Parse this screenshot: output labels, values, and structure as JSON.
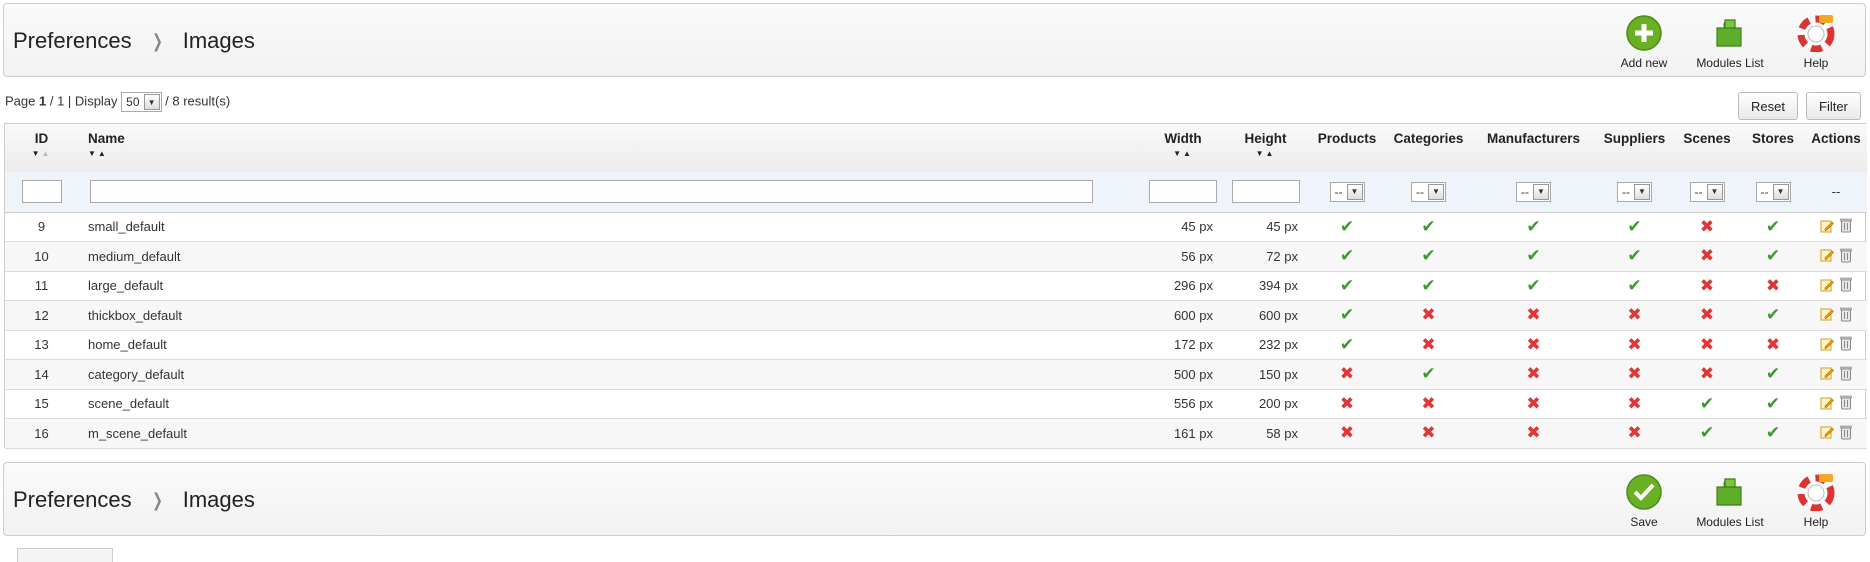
{
  "header": {
    "breadcrumb": [
      "Preferences",
      "Images"
    ],
    "buttons": [
      {
        "label": "Add new",
        "icon": "add-icon"
      },
      {
        "label": "Modules List",
        "icon": "puzzle-icon"
      },
      {
        "label": "Help",
        "icon": "lifebuoy-icon"
      }
    ]
  },
  "pager": {
    "page_label": "Page",
    "page_current": "1",
    "page_total": "/ 1 | Display",
    "per_page": "50",
    "results": "/ 8 result(s)"
  },
  "actions": {
    "reset": "Reset",
    "filter": "Filter"
  },
  "columns": [
    "ID",
    "Name",
    "Width",
    "Height",
    "Products",
    "Categories",
    "Manufacturers",
    "Suppliers",
    "Scenes",
    "Stores",
    "Actions"
  ],
  "filters": {
    "select_value": "--",
    "actions_value": "--"
  },
  "rows": [
    {
      "id": "9",
      "name": "small_default",
      "width": "45 px",
      "height": "45 px",
      "products": true,
      "categories": true,
      "manufacturers": true,
      "suppliers": true,
      "scenes": false,
      "stores": true
    },
    {
      "id": "10",
      "name": "medium_default",
      "width": "56 px",
      "height": "72 px",
      "products": true,
      "categories": true,
      "manufacturers": true,
      "suppliers": true,
      "scenes": false,
      "stores": true
    },
    {
      "id": "11",
      "name": "large_default",
      "width": "296 px",
      "height": "394 px",
      "products": true,
      "categories": true,
      "manufacturers": true,
      "suppliers": true,
      "scenes": false,
      "stores": false
    },
    {
      "id": "12",
      "name": "thickbox_default",
      "width": "600 px",
      "height": "600 px",
      "products": true,
      "categories": false,
      "manufacturers": false,
      "suppliers": false,
      "scenes": false,
      "stores": true
    },
    {
      "id": "13",
      "name": "home_default",
      "width": "172 px",
      "height": "232 px",
      "products": true,
      "categories": false,
      "manufacturers": false,
      "suppliers": false,
      "scenes": false,
      "stores": false
    },
    {
      "id": "14",
      "name": "category_default",
      "width": "500 px",
      "height": "150 px",
      "products": false,
      "categories": true,
      "manufacturers": false,
      "suppliers": false,
      "scenes": false,
      "stores": true
    },
    {
      "id": "15",
      "name": "scene_default",
      "width": "556 px",
      "height": "200 px",
      "products": false,
      "categories": false,
      "manufacturers": false,
      "suppliers": false,
      "scenes": true,
      "stores": true
    },
    {
      "id": "16",
      "name": "m_scene_default",
      "width": "161 px",
      "height": "58 px",
      "products": false,
      "categories": false,
      "manufacturers": false,
      "suppliers": false,
      "scenes": true,
      "stores": true
    }
  ],
  "footer": {
    "breadcrumb": [
      "Preferences",
      "Images"
    ],
    "buttons": [
      {
        "label": "Save",
        "icon": "save-icon"
      },
      {
        "label": "Modules List",
        "icon": "puzzle-icon"
      },
      {
        "label": "Help",
        "icon": "lifebuoy-icon"
      }
    ]
  },
  "colors": {
    "check": "#3c9a2f",
    "cross": "#e03636",
    "add": "#6ab023"
  }
}
